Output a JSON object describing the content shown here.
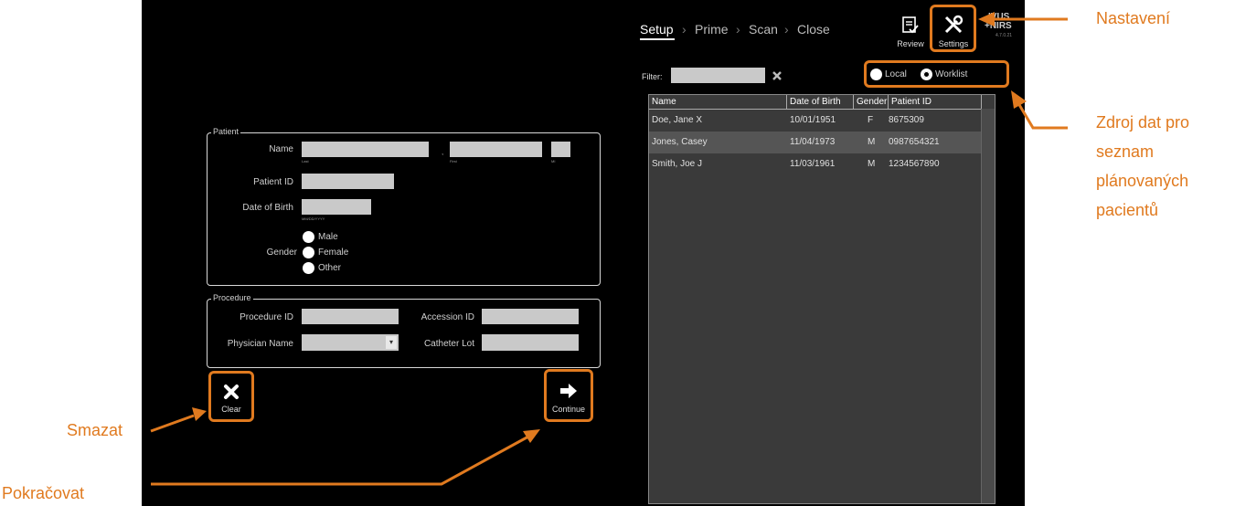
{
  "steps": [
    "Setup",
    "Prime",
    "Scan",
    "Close"
  ],
  "separator": "›",
  "toolbar": {
    "review_label": "Review",
    "settings_label": "Settings"
  },
  "brand": {
    "line1": "IVUS",
    "line2": "+NIRS",
    "version": "4.7.0.21"
  },
  "filter": {
    "label": "Filter:",
    "value": ""
  },
  "source": {
    "local_label": "Local",
    "worklist_label": "Worklist",
    "selected": "Worklist"
  },
  "table": {
    "headers": [
      "Name",
      "Date of Birth",
      "Gender",
      "Patient ID"
    ],
    "rows": [
      {
        "name": "Doe, Jane X",
        "dob": "10/01/1951",
        "gender": "F",
        "patient_id": "8675309",
        "selected": false
      },
      {
        "name": "Jones, Casey",
        "dob": "11/04/1973",
        "gender": "M",
        "patient_id": "0987654321",
        "selected": true
      },
      {
        "name": "Smith, Joe J",
        "dob": "11/03/1961",
        "gender": "M",
        "patient_id": "1234567890",
        "selected": false
      }
    ]
  },
  "patient": {
    "legend": "Patient",
    "name_label": "Name",
    "last_hint": "Last",
    "first_hint": "First",
    "mi_hint": "MI",
    "name_comma": ",",
    "patient_id_label": "Patient ID",
    "dob_label": "Date of Birth",
    "dob_hint": "MM/DD/YYYY",
    "gender_label": "Gender",
    "gender_options": [
      "Male",
      "Female",
      "Other"
    ]
  },
  "procedure": {
    "legend": "Procedure",
    "procedure_id_label": "Procedure ID",
    "accession_id_label": "Accession ID",
    "physician_label": "Physician Name",
    "catheter_lot_label": "Catheter Lot",
    "dropdown_arrow": "▾"
  },
  "actions": {
    "clear_label": "Clear",
    "continue_label": "Continue"
  },
  "callouts": {
    "settings": "Nastavení",
    "source": [
      "Zdroj dat pro",
      "seznam",
      "plánovaných",
      "pacientů"
    ],
    "clear": "Smazat",
    "continue": "Pokračovat"
  },
  "colors": {
    "accent_orange": "#e07a1f",
    "screen_bg": "#000000",
    "field_bg": "#c9c9c9",
    "table_bg": "#3a3a3a",
    "row_selected": "#555555"
  }
}
